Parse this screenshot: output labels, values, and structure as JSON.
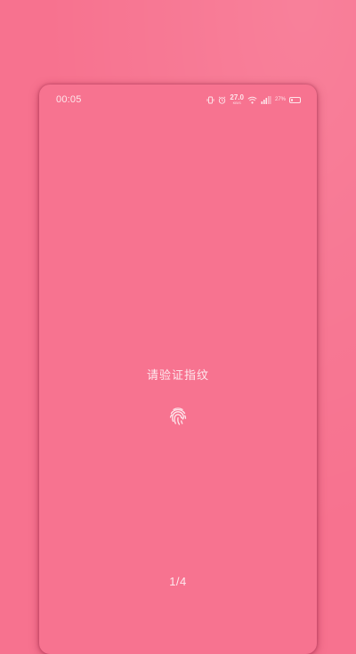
{
  "status_bar": {
    "time": "00:05",
    "icons": [
      "vibrate-icon",
      "alarm-icon",
      "wifi-icon",
      "cellular-signal-icon",
      "battery-icon"
    ],
    "net_speed": "27.0",
    "net_speed_unit": "KB/S",
    "battery_percent": "27%",
    "battery_level": 0.27
  },
  "lock": {
    "prompt": "请验证指纹",
    "icon": "fingerprint-icon",
    "page_indicator": "1/4"
  },
  "colors": {
    "background": "#f7728f",
    "card": "#f77390",
    "text": "#fde9ee"
  }
}
